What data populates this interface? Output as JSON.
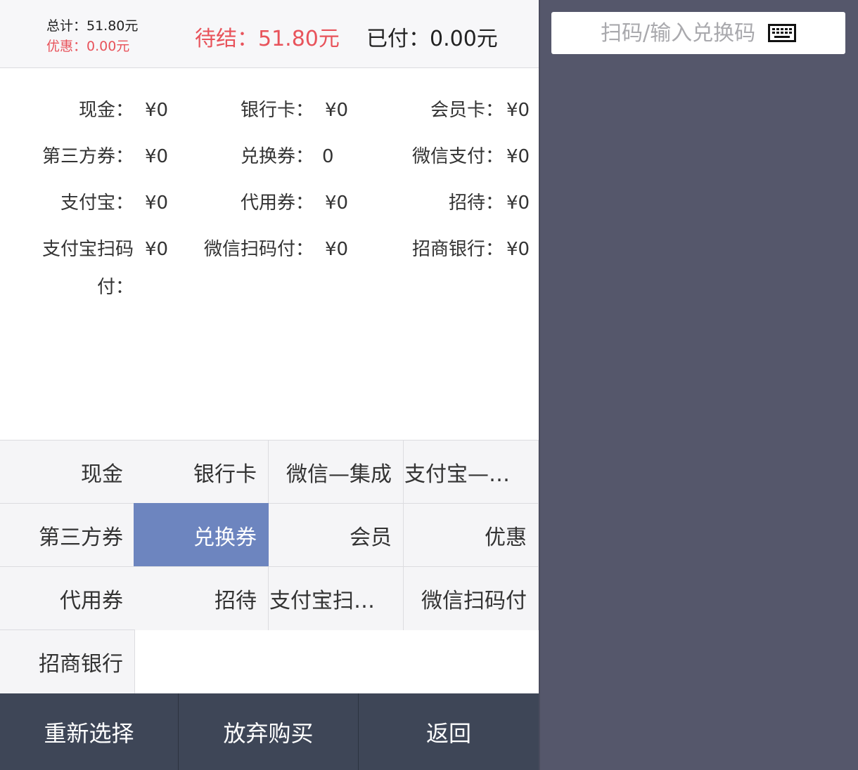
{
  "summary": {
    "total": "总计：51.80元",
    "discount": "优惠：0.00元",
    "pending": "待结：51.80元",
    "paid": "已付：0.00元"
  },
  "breakdown": [
    {
      "label": "现金：",
      "value": "¥0"
    },
    {
      "label": "银行卡：",
      "value": "¥0"
    },
    {
      "label": "会员卡：",
      "value": "¥0"
    },
    {
      "label": "第三方券：",
      "value": "¥0"
    },
    {
      "label": "兑换券：",
      "value": "0"
    },
    {
      "label": "微信支付：",
      "value": "¥0"
    },
    {
      "label": "支付宝：",
      "value": "¥0"
    },
    {
      "label": "代用券：",
      "value": "¥0"
    },
    {
      "label": "招待：",
      "value": "¥0"
    },
    {
      "label": "支付宝扫码付：",
      "value": "¥0"
    },
    {
      "label": "微信扫码付：",
      "value": "¥0"
    },
    {
      "label": "招商银行：",
      "value": "¥0"
    }
  ],
  "methods": [
    "现金",
    "银行卡",
    "微信—集成",
    "支付宝—…",
    "第三方券",
    "兑换券",
    "会员",
    "优惠",
    "代用券",
    "招待",
    "支付宝扫…",
    "微信扫码付",
    "招商银行"
  ],
  "active_method": "兑换券",
  "footer": {
    "reselect": "重新选择",
    "abandon": "放弃购买",
    "back": "返回"
  },
  "code": {
    "placeholder": "扫码/输入兑换码",
    "value": ""
  },
  "colors": {
    "accent_red": "#e8535b",
    "active_tile": "#6d85bf",
    "footer_bg": "#3e4657",
    "right_bg": "#55576b"
  },
  "icons": {
    "code_input": "keyboard-icon"
  }
}
